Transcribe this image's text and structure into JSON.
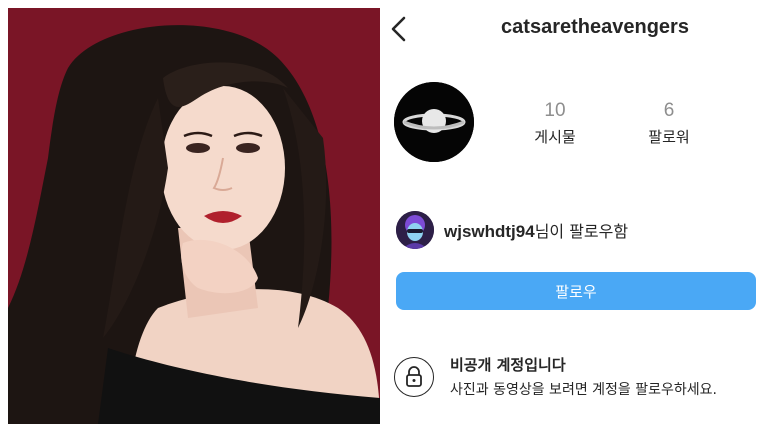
{
  "profile": {
    "username": "catsaretheavengers",
    "stats": {
      "posts_count": "10",
      "posts_label": "게시물",
      "followers_count": "6",
      "followers_label": "팔로워"
    },
    "followed_by": {
      "user": "wjswhdtj94",
      "suffix": "님이 팔로우함"
    },
    "follow_button_label": "팔로우",
    "private_notice": {
      "title": "비공개 계정입니다",
      "subtitle": "사진과 동영상을 보려면 계정을 팔로우하세요."
    }
  },
  "colors": {
    "follow_button": "#4aa8f5",
    "photo_background": "#7a1526",
    "text": "#262626",
    "muted_count": "#8e8e8e"
  },
  "icons": {
    "back": "chevron-left-icon",
    "lock": "lock-icon"
  }
}
